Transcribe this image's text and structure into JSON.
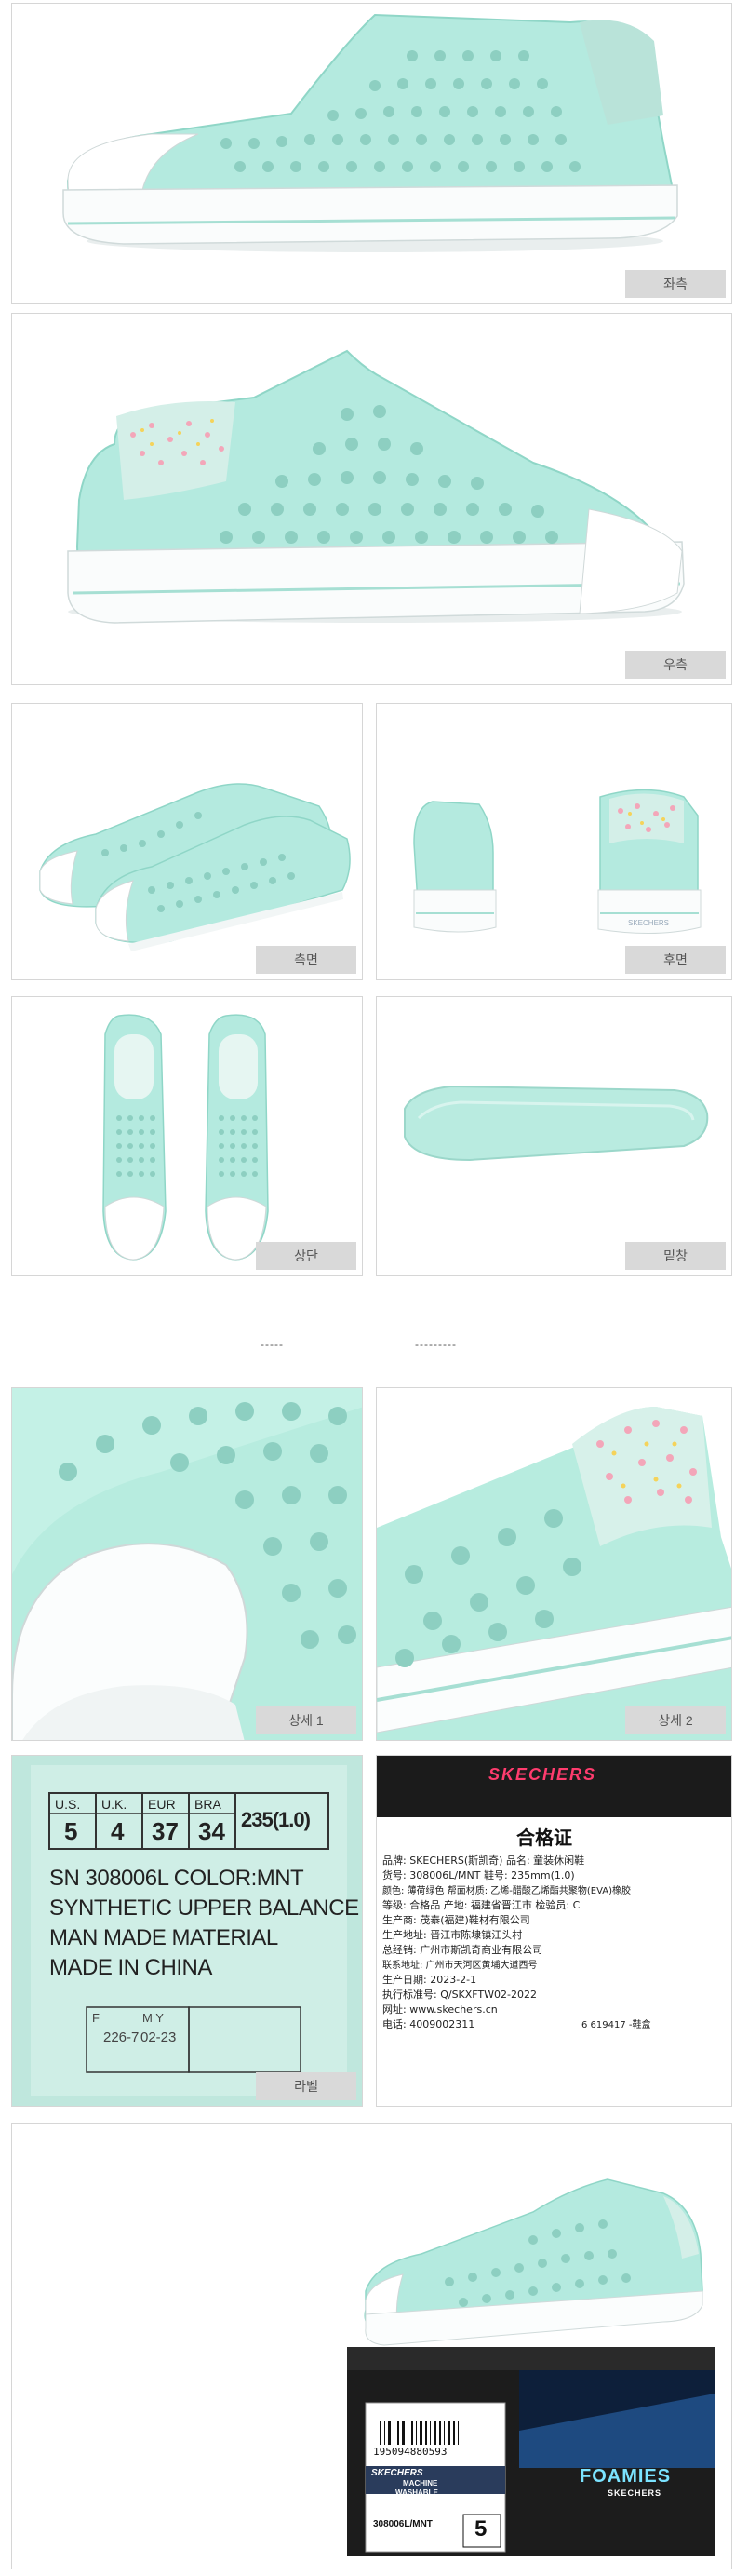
{
  "views": {
    "left": "좌측",
    "right": "우측",
    "side": "측면",
    "back": "후면",
    "top": "상단",
    "sole": "밑창",
    "detail1": "상세 1",
    "detail2": "상세 2",
    "label": "라벨"
  },
  "dividers": [
    "-----",
    "---------"
  ],
  "shoe_label": {
    "size_headers": [
      "U.S.",
      "U.K.",
      "EUR",
      "BRA"
    ],
    "size_values": [
      "5",
      "4",
      "37",
      "34"
    ],
    "mm": "235(1.0)",
    "line1": "SN 308006L COLOR:MNT",
    "line2": "SYNTHETIC UPPER BALANCE",
    "line3": "MAN MADE MATERIAL",
    "line4": "MADE IN CHINA",
    "f_label": "F",
    "f_value": "226-7",
    "my_label": "M Y",
    "my_value": "02-23"
  },
  "certificate": {
    "brand_banner": "SKECHERS",
    "title": "合格证",
    "rows": [
      "品牌: SKECHERS(斯凯奇)   品名: 童装休闲鞋",
      "货号: 308006L/MNT      鞋号: 235mm(1.0)",
      "颜色: 薄荷绿色         帮面材质: 乙烯-醋酸乙烯酯共聚物(EVA)橡胶",
      "等级: 合格品           产地: 福建省晋江市    检验员: C",
      "生产商: 茂泰(福建)鞋材有限公司",
      "生产地址: 晋江市陈埭镇江头村",
      "总经销: 广州市斯凯奇商业有限公司",
      "联系地址: 广州市天河区黄埔大道西号",
      "生产日期: 2023-2-1",
      "执行标准号: Q/SKXFTW02-2022",
      "网址: www.skechers.cn",
      "电话: 4009002311"
    ],
    "barcode_text": "6 619417  -鞋盒"
  },
  "box": {
    "brand": "FOAMIES",
    "sub_brand": "SKECHERS",
    "barcode": "195094880593",
    "machine": "MACHINE",
    "washable": "WASHABLE",
    "sku": "308006L/MNT",
    "size": "5"
  },
  "colors": {
    "mint": "#a9e4d8",
    "mint_dark": "#7fcfbf",
    "sole": "#ffffff",
    "tag_bg": "#d9d9d9"
  }
}
